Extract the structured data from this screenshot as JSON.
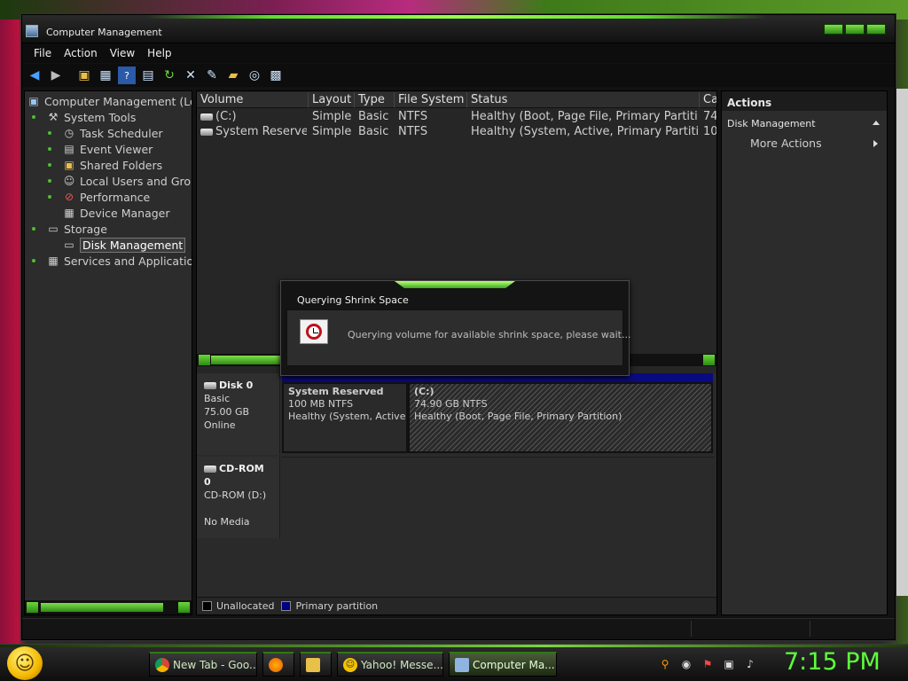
{
  "window": {
    "title": "Computer Management"
  },
  "menu": [
    "File",
    "Action",
    "View",
    "Help"
  ],
  "tree": {
    "root": "Computer Management (Loc",
    "items": [
      {
        "label": "System Tools",
        "level": 1,
        "icon": "tools-icon"
      },
      {
        "label": "Task Scheduler",
        "level": 2,
        "icon": "clock-icon"
      },
      {
        "label": "Event Viewer",
        "level": 2,
        "icon": "event-viewer-icon"
      },
      {
        "label": "Shared Folders",
        "level": 2,
        "icon": "shared-folders-icon"
      },
      {
        "label": "Local Users and Grou",
        "level": 2,
        "icon": "users-icon"
      },
      {
        "label": "Performance",
        "level": 2,
        "icon": "performance-icon"
      },
      {
        "label": "Device Manager",
        "level": 2,
        "icon": "device-manager-icon"
      },
      {
        "label": "Storage",
        "level": 1,
        "icon": "storage-icon"
      },
      {
        "label": "Disk Management",
        "level": 2,
        "icon": "disk-management-icon",
        "selected": true
      },
      {
        "label": "Services and Application",
        "level": 1,
        "icon": "services-icon"
      }
    ]
  },
  "volume_list": {
    "columns": [
      "Volume",
      "Layout",
      "Type",
      "File System",
      "Status",
      "Ca"
    ],
    "rows": [
      [
        "(C:)",
        "Simple",
        "Basic",
        "NTFS",
        "Healthy (Boot, Page File, Primary Partition)",
        "74"
      ],
      [
        "System Reserved",
        "Simple",
        "Basic",
        "NTFS",
        "Healthy (System, Active, Primary Partition)",
        "10"
      ]
    ]
  },
  "disks": [
    {
      "name": "Disk 0",
      "type": "Basic",
      "size": "75.00 GB",
      "state": "Online",
      "partitions": [
        {
          "name": "System Reserved",
          "size": "100 MB NTFS",
          "status": "Healthy (System, Active, P"
        },
        {
          "name": "(C:)",
          "size": "74.90 GB NTFS",
          "status": "Healthy (Boot, Page File, Primary Partition)"
        }
      ]
    },
    {
      "name": "CD-ROM 0",
      "type": "CD-ROM (D:)",
      "state": "No Media"
    }
  ],
  "legend": {
    "unallocated": "Unallocated",
    "primary": "Primary partition",
    "unallocated_color": "#000000",
    "primary_color": "#000080"
  },
  "actions": {
    "header": "Actions",
    "section": "Disk Management",
    "more": "More Actions"
  },
  "dialog": {
    "title": "Querying Shrink Space",
    "message": "Querying volume for available shrink space, please wait..."
  },
  "taskbar": {
    "buttons": [
      {
        "label": "New Tab - Goo...",
        "icon": "chrome-icon"
      },
      {
        "label": "",
        "icon": "firefox-icon"
      },
      {
        "label": "",
        "icon": "folder-icon"
      },
      {
        "label": "Yahoo! Messe...",
        "icon": "yahoo-messenger-icon"
      },
      {
        "label": "Computer Ma...",
        "icon": "computer-management-icon",
        "active": true
      }
    ],
    "clock": "7:15 PM"
  },
  "colors": {
    "accent": "#5dff3a",
    "window_bg": "#121212"
  }
}
